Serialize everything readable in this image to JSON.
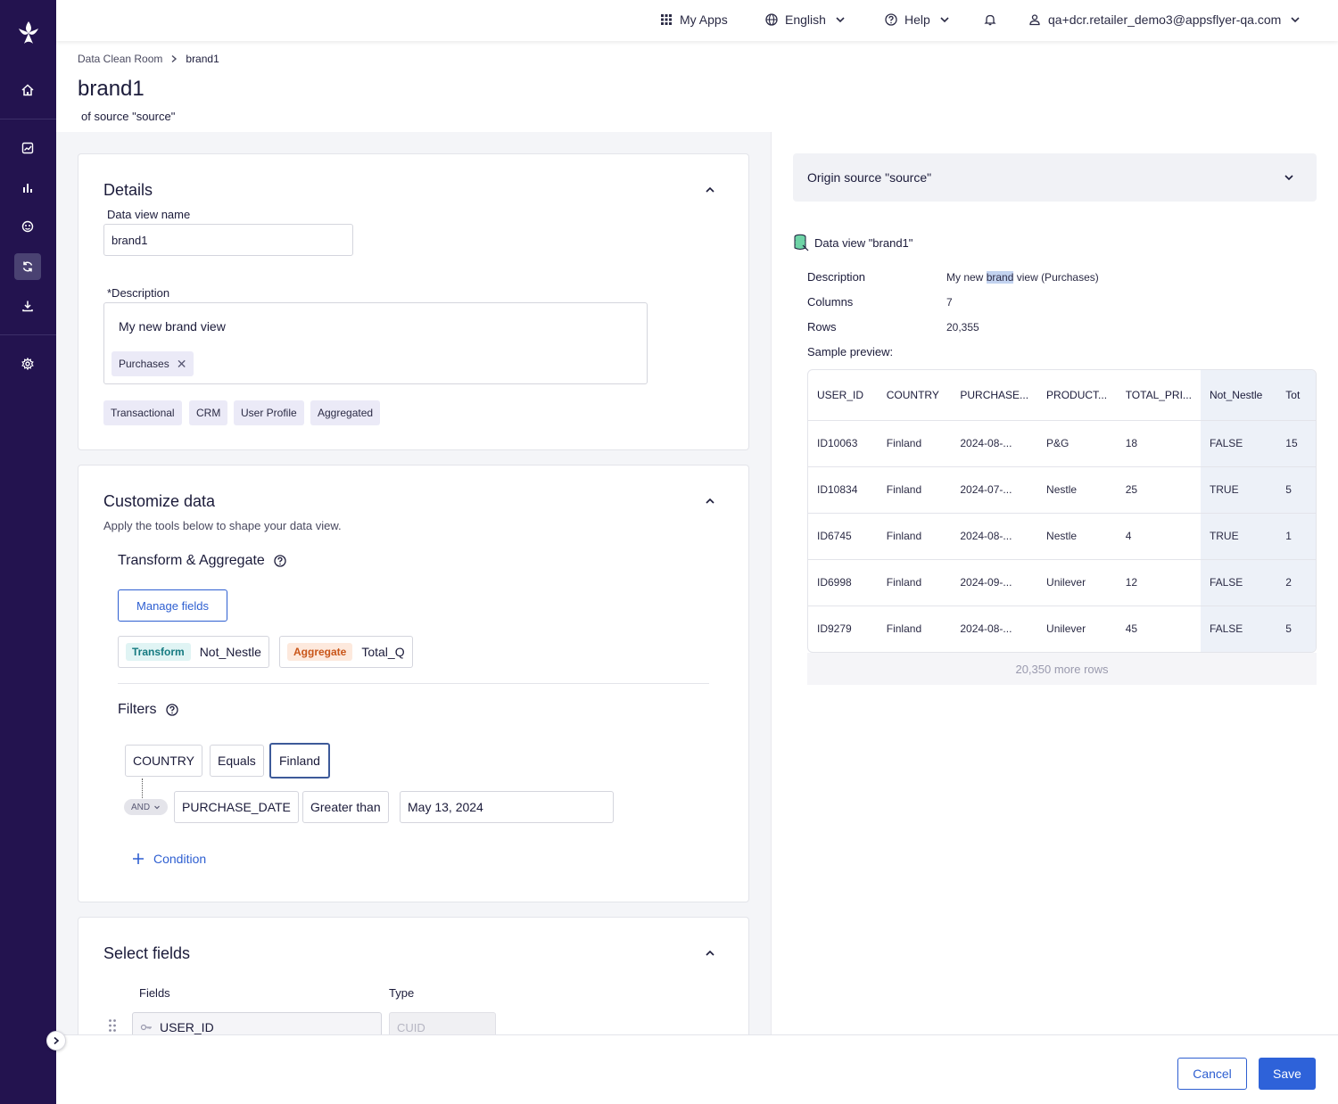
{
  "topbar": {
    "my_apps": "My Apps",
    "language": "English",
    "help": "Help",
    "user_email": "qa+dcr.retailer_demo3@appsflyer-qa.com"
  },
  "breadcrumb": {
    "root": "Data Clean Room",
    "current": "brand1"
  },
  "page": {
    "title": "brand1",
    "subtitle": "of source \"source\""
  },
  "details": {
    "title": "Details",
    "name_label": "Data view name",
    "name_value": "brand1",
    "description_label": "*Description",
    "description_value": "My new brand view",
    "description_chip": "Purchases",
    "suggested_chips": [
      "Transactional",
      "CRM",
      "User Profile",
      "Aggregated"
    ]
  },
  "customize": {
    "title": "Customize data",
    "hint": "Apply the tools below to shape your data view.",
    "transform_heading": "Transform & Aggregate",
    "manage_fields": "Manage fields",
    "transform_tag": "Transform",
    "transform_field": "Not_Nestle",
    "aggregate_tag": "Aggregate",
    "aggregate_field": "Total_Q",
    "filters_heading": "Filters",
    "filter1": {
      "field": "COUNTRY",
      "op": "Equals",
      "value": "Finland"
    },
    "operator": "AND",
    "filter2": {
      "field": "PURCHASE_DATE",
      "op": "Greater than",
      "value": "May 13, 2024"
    },
    "add_condition": "Condition"
  },
  "select_fields": {
    "title": "Select fields",
    "col_fields": "Fields",
    "col_type": "Type",
    "first_field": "USER_ID",
    "first_type": "CUID"
  },
  "right": {
    "origin": "Origin source \"source\"",
    "data_view_title": "Data view \"brand1\"",
    "description_label": "Description",
    "description_pre": "My new ",
    "description_hl": "brand",
    "description_post": " view (Purchases)",
    "columns_label": "Columns",
    "columns_value": "7",
    "rows_label": "Rows",
    "rows_value": "20,355",
    "sample_label": "Sample preview:",
    "table": {
      "headers": [
        "USER_ID",
        "COUNTRY",
        "PURCHASE...",
        "PRODUCT...",
        "TOTAL_PRI...",
        "Not_Nestle",
        "Tot"
      ],
      "rows": [
        [
          "ID10063",
          "Finland",
          "2024-08-...",
          "P&G",
          "18",
          "FALSE",
          "15"
        ],
        [
          "ID10834",
          "Finland",
          "2024-07-...",
          "Nestle",
          "25",
          "TRUE",
          "5"
        ],
        [
          "ID6745",
          "Finland",
          "2024-08-...",
          "Nestle",
          "4",
          "TRUE",
          "1"
        ],
        [
          "ID6998",
          "Finland",
          "2024-09-...",
          "Unilever",
          "12",
          "FALSE",
          "2"
        ],
        [
          "ID9279",
          "Finland",
          "2024-08-...",
          "Unilever",
          "45",
          "FALSE",
          "5"
        ]
      ]
    },
    "more_rows": "20,350 more rows"
  },
  "footer": {
    "cancel": "Cancel",
    "save": "Save"
  }
}
